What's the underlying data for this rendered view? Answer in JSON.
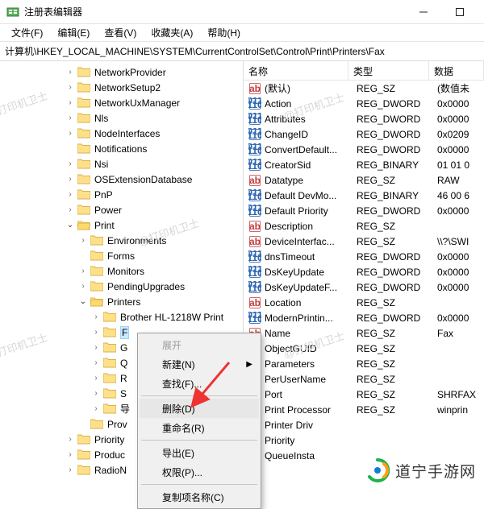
{
  "window": {
    "title": "注册表编辑器"
  },
  "menu": {
    "file": "文件(F)",
    "edit": "编辑(E)",
    "view": "查看(V)",
    "fav": "收藏夹(A)",
    "help": "帮助(H)"
  },
  "address": "计算机\\HKEY_LOCAL_MACHINE\\SYSTEM\\CurrentControlSet\\Control\\Print\\Printers\\Fax",
  "tree": [
    {
      "indent": 80,
      "exp": ">",
      "label": "NetworkProvider"
    },
    {
      "indent": 80,
      "exp": ">",
      "label": "NetworkSetup2"
    },
    {
      "indent": 80,
      "exp": ">",
      "label": "NetworkUxManager"
    },
    {
      "indent": 80,
      "exp": ">",
      "label": "Nls"
    },
    {
      "indent": 80,
      "exp": ">",
      "label": "NodeInterfaces"
    },
    {
      "indent": 80,
      "exp": "",
      "label": "Notifications"
    },
    {
      "indent": 80,
      "exp": ">",
      "label": "Nsi"
    },
    {
      "indent": 80,
      "exp": ">",
      "label": "OSExtensionDatabase"
    },
    {
      "indent": 80,
      "exp": ">",
      "label": "PnP"
    },
    {
      "indent": 80,
      "exp": ">",
      "label": "Power"
    },
    {
      "indent": 80,
      "exp": "v",
      "label": "Print",
      "open": true
    },
    {
      "indent": 96,
      "exp": ">",
      "label": "Environments"
    },
    {
      "indent": 96,
      "exp": "",
      "label": "Forms"
    },
    {
      "indent": 96,
      "exp": ">",
      "label": "Monitors"
    },
    {
      "indent": 96,
      "exp": ">",
      "label": "PendingUpgrades"
    },
    {
      "indent": 96,
      "exp": "v",
      "label": "Printers",
      "open": true
    },
    {
      "indent": 112,
      "exp": ">",
      "label": "Brother HL-1218W Print"
    },
    {
      "indent": 112,
      "exp": ">",
      "label": "F",
      "selected": true
    },
    {
      "indent": 112,
      "exp": ">",
      "label": "G"
    },
    {
      "indent": 112,
      "exp": ">",
      "label": "Q"
    },
    {
      "indent": 112,
      "exp": ">",
      "label": "R"
    },
    {
      "indent": 112,
      "exp": ">",
      "label": "S"
    },
    {
      "indent": 112,
      "exp": ">",
      "label": "导"
    },
    {
      "indent": 96,
      "exp": "",
      "label": "Prov"
    },
    {
      "indent": 80,
      "exp": ">",
      "label": "Priority"
    },
    {
      "indent": 80,
      "exp": ">",
      "label": "Produc"
    },
    {
      "indent": 80,
      "exp": ">",
      "label": "RadioN"
    }
  ],
  "columns": {
    "name": "名称",
    "type": "类型",
    "data": "数据"
  },
  "values": [
    {
      "icon": "str",
      "name": "(默认)",
      "type": "REG_SZ",
      "data": "(数值未"
    },
    {
      "icon": "bin",
      "name": "Action",
      "type": "REG_DWORD",
      "data": "0x0000"
    },
    {
      "icon": "bin",
      "name": "Attributes",
      "type": "REG_DWORD",
      "data": "0x0000"
    },
    {
      "icon": "bin",
      "name": "ChangeID",
      "type": "REG_DWORD",
      "data": "0x0209"
    },
    {
      "icon": "bin",
      "name": "ConvertDefault...",
      "type": "REG_DWORD",
      "data": "0x0000"
    },
    {
      "icon": "bin",
      "name": "CreatorSid",
      "type": "REG_BINARY",
      "data": "01 01 0"
    },
    {
      "icon": "str",
      "name": "Datatype",
      "type": "REG_SZ",
      "data": "RAW"
    },
    {
      "icon": "bin",
      "name": "Default DevMo...",
      "type": "REG_BINARY",
      "data": "46 00 6"
    },
    {
      "icon": "bin",
      "name": "Default Priority",
      "type": "REG_DWORD",
      "data": "0x0000"
    },
    {
      "icon": "str",
      "name": "Description",
      "type": "REG_SZ",
      "data": ""
    },
    {
      "icon": "str",
      "name": "DeviceInterfac...",
      "type": "REG_SZ",
      "data": "\\\\?\\SWI"
    },
    {
      "icon": "bin",
      "name": "dnsTimeout",
      "type": "REG_DWORD",
      "data": "0x0000"
    },
    {
      "icon": "bin",
      "name": "DsKeyUpdate",
      "type": "REG_DWORD",
      "data": "0x0000"
    },
    {
      "icon": "bin",
      "name": "DsKeyUpdateF...",
      "type": "REG_DWORD",
      "data": "0x0000"
    },
    {
      "icon": "str",
      "name": "Location",
      "type": "REG_SZ",
      "data": ""
    },
    {
      "icon": "bin",
      "name": "ModernPrintin...",
      "type": "REG_DWORD",
      "data": "0x0000"
    },
    {
      "icon": "str",
      "name": "Name",
      "type": "REG_SZ",
      "data": "Fax"
    },
    {
      "icon": "str",
      "name": "ObjectGUID",
      "type": "REG_SZ",
      "data": ""
    },
    {
      "icon": "str",
      "name": "Parameters",
      "type": "REG_SZ",
      "data": ""
    },
    {
      "icon": "str",
      "name": "PerUserName",
      "type": "REG_SZ",
      "data": ""
    },
    {
      "icon": "str",
      "name": "Port",
      "type": "REG_SZ",
      "data": "SHRFAX"
    },
    {
      "icon": "str",
      "name": "Print Processor",
      "type": "REG_SZ",
      "data": "winprin"
    },
    {
      "icon": "str",
      "name": "Printer Driv",
      "type": "",
      "data": ""
    },
    {
      "icon": "bin",
      "name": "Priority",
      "type": "",
      "data": ""
    },
    {
      "icon": "bin",
      "name": "QueueInsta",
      "type": "",
      "data": ""
    }
  ],
  "context": {
    "expand": "展开",
    "new": "新建(N)",
    "find": "查找(F)...",
    "delete": "删除(D)",
    "rename": "重命名(R)",
    "export": "导出(E)",
    "perm": "权限(P)...",
    "copyname": "复制项名称(C)"
  },
  "watermark": "@打印机卫士",
  "brand": "道宁手游网"
}
